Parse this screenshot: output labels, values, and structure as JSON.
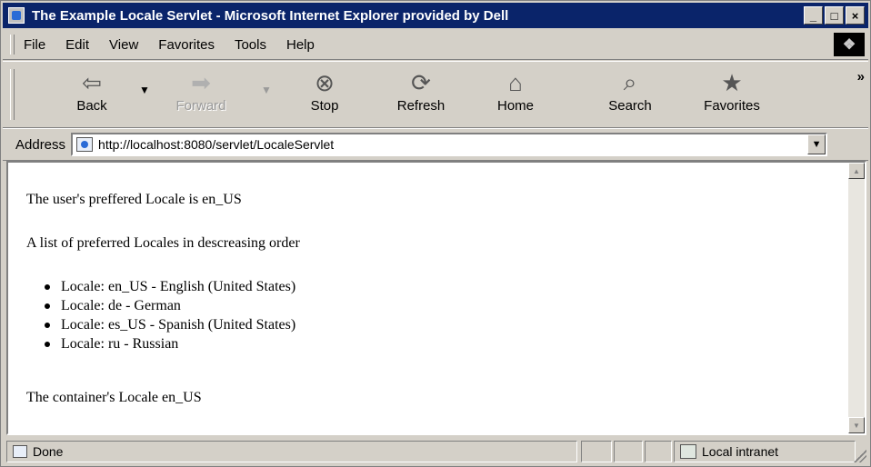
{
  "window": {
    "title": "The Example Locale Servlet - Microsoft Internet Explorer provided by Dell",
    "controls": {
      "minimize": "_",
      "maximize": "□",
      "close": "×"
    }
  },
  "menu": {
    "items": [
      {
        "label": "File"
      },
      {
        "label": "Edit"
      },
      {
        "label": "View"
      },
      {
        "label": "Favorites"
      },
      {
        "label": "Tools"
      },
      {
        "label": "Help"
      }
    ]
  },
  "toolbar": {
    "buttons": [
      {
        "label": "Back",
        "icon": "back-arrow-icon",
        "glyph": "⇦"
      },
      {
        "label": "Forward",
        "icon": "forward-arrow-icon",
        "glyph": "➡"
      },
      {
        "label": "Stop",
        "icon": "stop-icon",
        "glyph": "⊗"
      },
      {
        "label": "Refresh",
        "icon": "refresh-icon",
        "glyph": "⟳"
      },
      {
        "label": "Home",
        "icon": "home-icon",
        "glyph": "⌂"
      },
      {
        "label": "Search",
        "icon": "search-icon",
        "glyph": "⌕"
      },
      {
        "label": "Favorites",
        "icon": "favorites-icon",
        "glyph": "★"
      }
    ],
    "more_glyph": "»"
  },
  "address": {
    "label": "Address",
    "url": "http://localhost:8080/servlet/LocaleServlet"
  },
  "page": {
    "preferred_line": "The user's preffered Locale is en_US",
    "list_intro": "A list of preferred Locales in descreasing order",
    "locales": [
      "Locale: en_US - English (United States)",
      "Locale: de - German",
      "Locale: es_US - Spanish (United States)",
      "Locale: ru - Russian"
    ],
    "container_line": "The container's Locale en_US"
  },
  "status": {
    "text": "Done",
    "zone": "Local intranet"
  },
  "colors": {
    "titlebar": "#0a246a",
    "chrome": "#d4d0c8",
    "content_bg": "#ffffff"
  }
}
